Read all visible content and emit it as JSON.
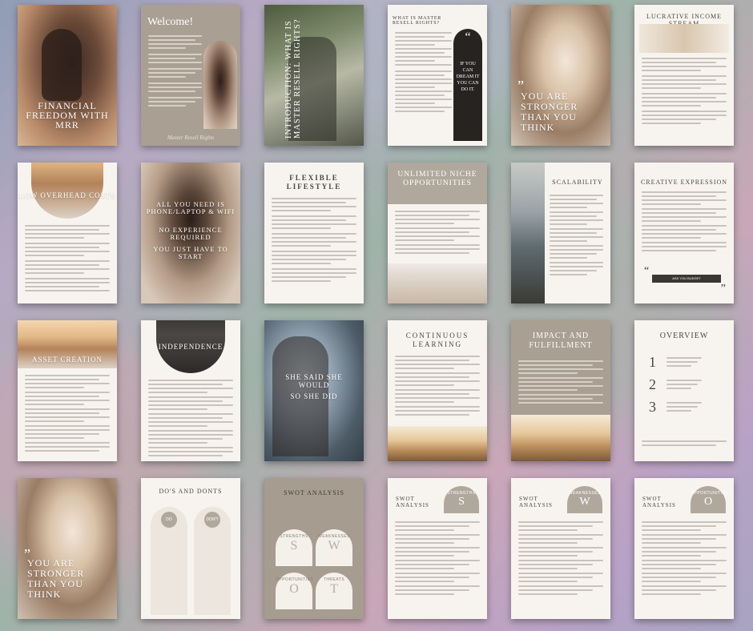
{
  "pages": {
    "p1": {
      "title": "FINANCIAL FREEDOM WITH MRR"
    },
    "p2": {
      "title": "Welcome!",
      "footer": "Master Resell Rights"
    },
    "p3": {
      "title": "INTRODUCTION: WHAT IS MASTER RESELL RIGHTS?"
    },
    "p4": {
      "title": "WHAT IS MASTER RESELL RIGHTS?",
      "quote": "IF YOU CAN DREAM IT YOU CAN DO IT."
    },
    "p5": {
      "title": "YOU ARE STRONGER THAN YOU THINK"
    },
    "p6": {
      "title": "LUCRATIVE INCOME STREAM"
    },
    "p7": {
      "title": "LOW OVERHEAD COSTS"
    },
    "p8": {
      "line1": "ALL YOU NEED IS PHONE/LAPTOP & WIFI",
      "line2": "NO EXPERIENCE REQUIRED",
      "line3": "YOU JUST HAVE TO START"
    },
    "p9": {
      "title": "FLEXIBLE LIFESTYLE"
    },
    "p10": {
      "title": "UNLIMITED NICHE OPPORTUNITIES"
    },
    "p11": {
      "title": "SCALABILITY"
    },
    "p12": {
      "title": "CREATIVE EXPRESSION",
      "btn": "ASK YOU BUDGET"
    },
    "p13": {
      "title": "ASSET CREATION"
    },
    "p14": {
      "title": "INDEPENDENCE"
    },
    "p15": {
      "line1": "SHE SAID SHE WOULD",
      "line2": "SO SHE DID"
    },
    "p16": {
      "title": "CONTINUOUS LEARNING"
    },
    "p17": {
      "title": "IMPACT AND FULFILLMENT"
    },
    "p18": {
      "title": "OVERVIEW",
      "n1": "1",
      "n2": "2",
      "n3": "3"
    },
    "p19": {
      "title": "YOU ARE STRONGER THAN YOU THINK"
    },
    "p20": {
      "title": "DO'S AND DONTS",
      "do": "DO",
      "dont": "DON'T"
    },
    "p21": {
      "title": "SWOT ANALYSIS",
      "s": "S",
      "w": "W",
      "o": "O",
      "t": "T",
      "s_label": "STRENGTHS",
      "w_label": "WEAKNESSES",
      "o_label": "OPPORTUNITIES",
      "t_label": "THREATS"
    },
    "p22": {
      "title": "SWOT ANALYSIS",
      "badge_label": "STRENGTHS",
      "badge_letter": "S"
    },
    "p23": {
      "title": "SWOT ANALYSIS",
      "badge_label": "WEAKNESSES",
      "badge_letter": "W"
    },
    "p24": {
      "title": "SWOT ANALYSIS",
      "badge_label": "OPPORTUNITIES",
      "badge_letter": "O"
    }
  }
}
